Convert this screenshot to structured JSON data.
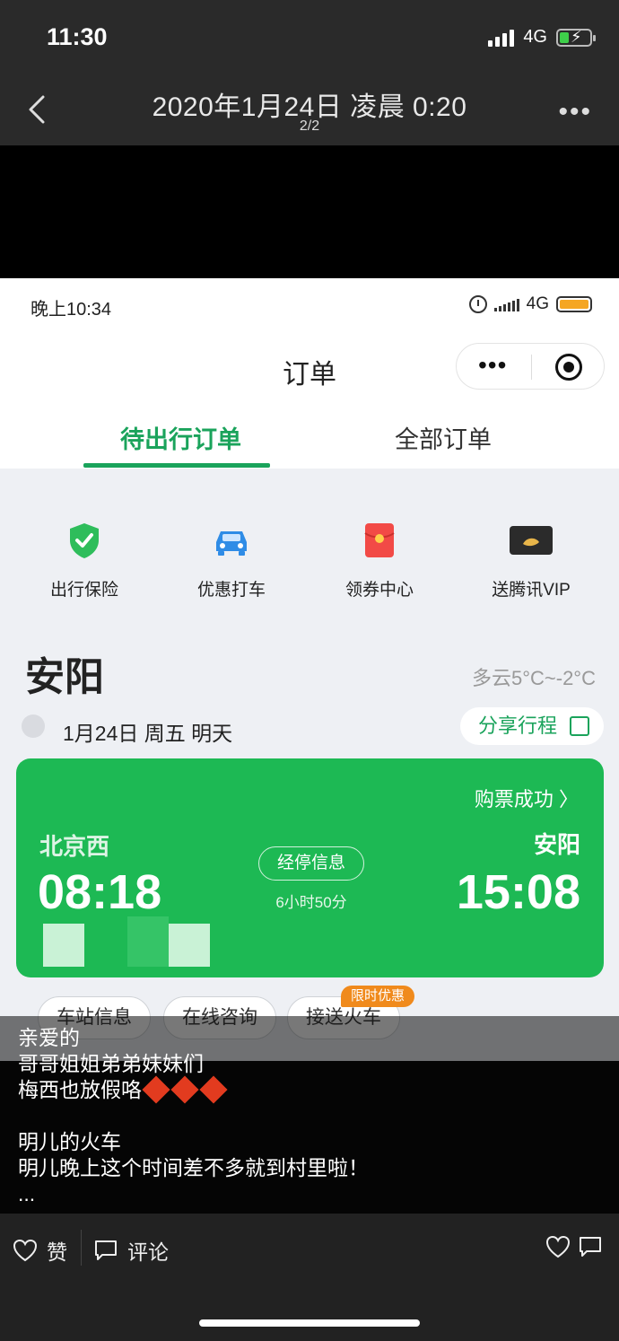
{
  "device_status": {
    "time": "11:30",
    "network": "4G"
  },
  "viewer": {
    "title": "2020年1月24日 凌晨 0:20",
    "counter": "2/2"
  },
  "inner": {
    "status": {
      "time": "晚上10:34",
      "network": "4G"
    },
    "header": {
      "title": "订单"
    },
    "tabs": [
      {
        "label": "待出行订单"
      },
      {
        "label": "全部订单"
      }
    ],
    "quick_links": [
      {
        "label": "出行保险",
        "icon": "shield-check-icon"
      },
      {
        "label": "优惠打车",
        "icon": "car-icon"
      },
      {
        "label": "领券中心",
        "icon": "red-envelope-icon"
      },
      {
        "label": "送腾讯VIP",
        "icon": "vip-card-icon"
      }
    ],
    "trip": {
      "city": "安阳",
      "weather": "多云5°C~-2°C",
      "date": "1月24日 周五 明天",
      "share_label": "分享行程",
      "status": "购票成功 〉",
      "from_station": "北京西",
      "to_station": "安阳",
      "depart_time": "08:18",
      "arrive_time": "15:08",
      "stops_label": "经停信息",
      "duration": "6小时50分"
    },
    "actions": [
      {
        "label": "车站信息"
      },
      {
        "label": "在线咨询"
      },
      {
        "label": "接送火车"
      }
    ],
    "promo_badge": "限时优惠"
  },
  "caption": {
    "lines": [
      "亲爱的",
      "哥哥姐姐弟弟妹妹们",
      "梅西也放假咯",
      "",
      "明儿的火车",
      "明儿晚上这个时间差不多就到村里啦！",
      "..."
    ]
  },
  "bottom_bar": {
    "like_label": "赞",
    "comment_label": "评论"
  },
  "colors": {
    "accent_green": "#1aa35b",
    "ticket_green": "#1db954",
    "promo_orange": "#f08a1c"
  }
}
